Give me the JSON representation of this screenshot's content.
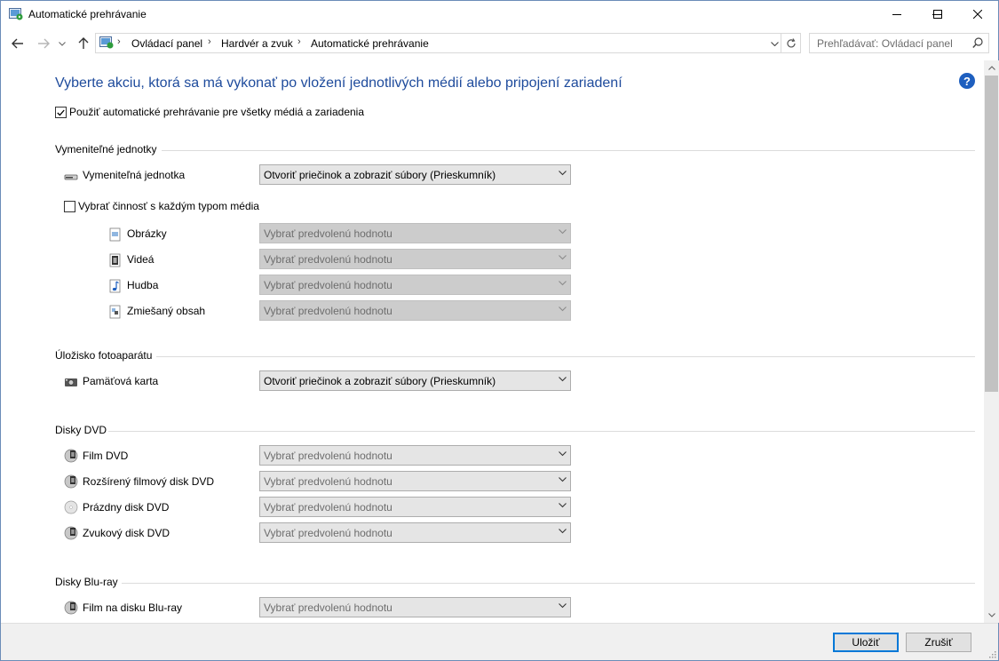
{
  "window": {
    "title": "Automatické prehrávanie"
  },
  "nav": {
    "crumbs": [
      "Ovládací panel",
      "Hardvér a zvuk",
      "Automatické prehrávanie"
    ],
    "search_placeholder": "Prehľadávať: Ovládací panel"
  },
  "main": {
    "heading": "Vyberte akciu, ktorá sa má vykonať po vložení jednotlivých médií alebo pripojení zariadení",
    "use_autoplay": {
      "label": "Použiť automatické prehrávanie pre všetky médiá a zariadenia",
      "checked": true
    },
    "removable": {
      "title": "Vymeniteľné jednotky",
      "drive_label": "Vymeniteľná jednotka",
      "drive_value": "Otvoriť priečinok a zobraziť súbory (Prieskumník)",
      "per_media": {
        "label": "Vybrať činnosť s každým typom média",
        "checked": false
      },
      "media": [
        {
          "label": "Obrázky",
          "icon": "pictures-icon",
          "value": "Vybrať predvolenú hodnotu"
        },
        {
          "label": "Videá",
          "icon": "videos-icon",
          "value": "Vybrať predvolenú hodnotu"
        },
        {
          "label": "Hudba",
          "icon": "music-icon",
          "value": "Vybrať predvolenú hodnotu"
        },
        {
          "label": "Zmiešaný obsah",
          "icon": "mixed-content-icon",
          "value": "Vybrať predvolenú hodnotu"
        }
      ]
    },
    "camera": {
      "title": "Úložisko fotoaparátu",
      "items": [
        {
          "label": "Pamäťová karta",
          "value": "Otvoriť priečinok a zobraziť súbory (Prieskumník)"
        }
      ]
    },
    "dvd": {
      "title": "Disky DVD",
      "items": [
        {
          "label": "Film DVD",
          "value": "Vybrať predvolenú hodnotu"
        },
        {
          "label": "Rozšírený filmový disk DVD",
          "value": "Vybrať predvolenú hodnotu"
        },
        {
          "label": "Prázdny disk DVD",
          "value": "Vybrať predvolenú hodnotu"
        },
        {
          "label": "Zvukový disk DVD",
          "value": "Vybrať predvolenú hodnotu"
        }
      ]
    },
    "bluray": {
      "title": "Disky Blu-ray",
      "items": [
        {
          "label": "Film na disku Blu-ray",
          "value": "Vybrať predvolenú hodnotu"
        }
      ]
    }
  },
  "footer": {
    "save_label": "Uložiť",
    "cancel_label": "Zrušiť"
  },
  "colors": {
    "heading": "#1e4b9c",
    "accent": "#0078d7"
  }
}
